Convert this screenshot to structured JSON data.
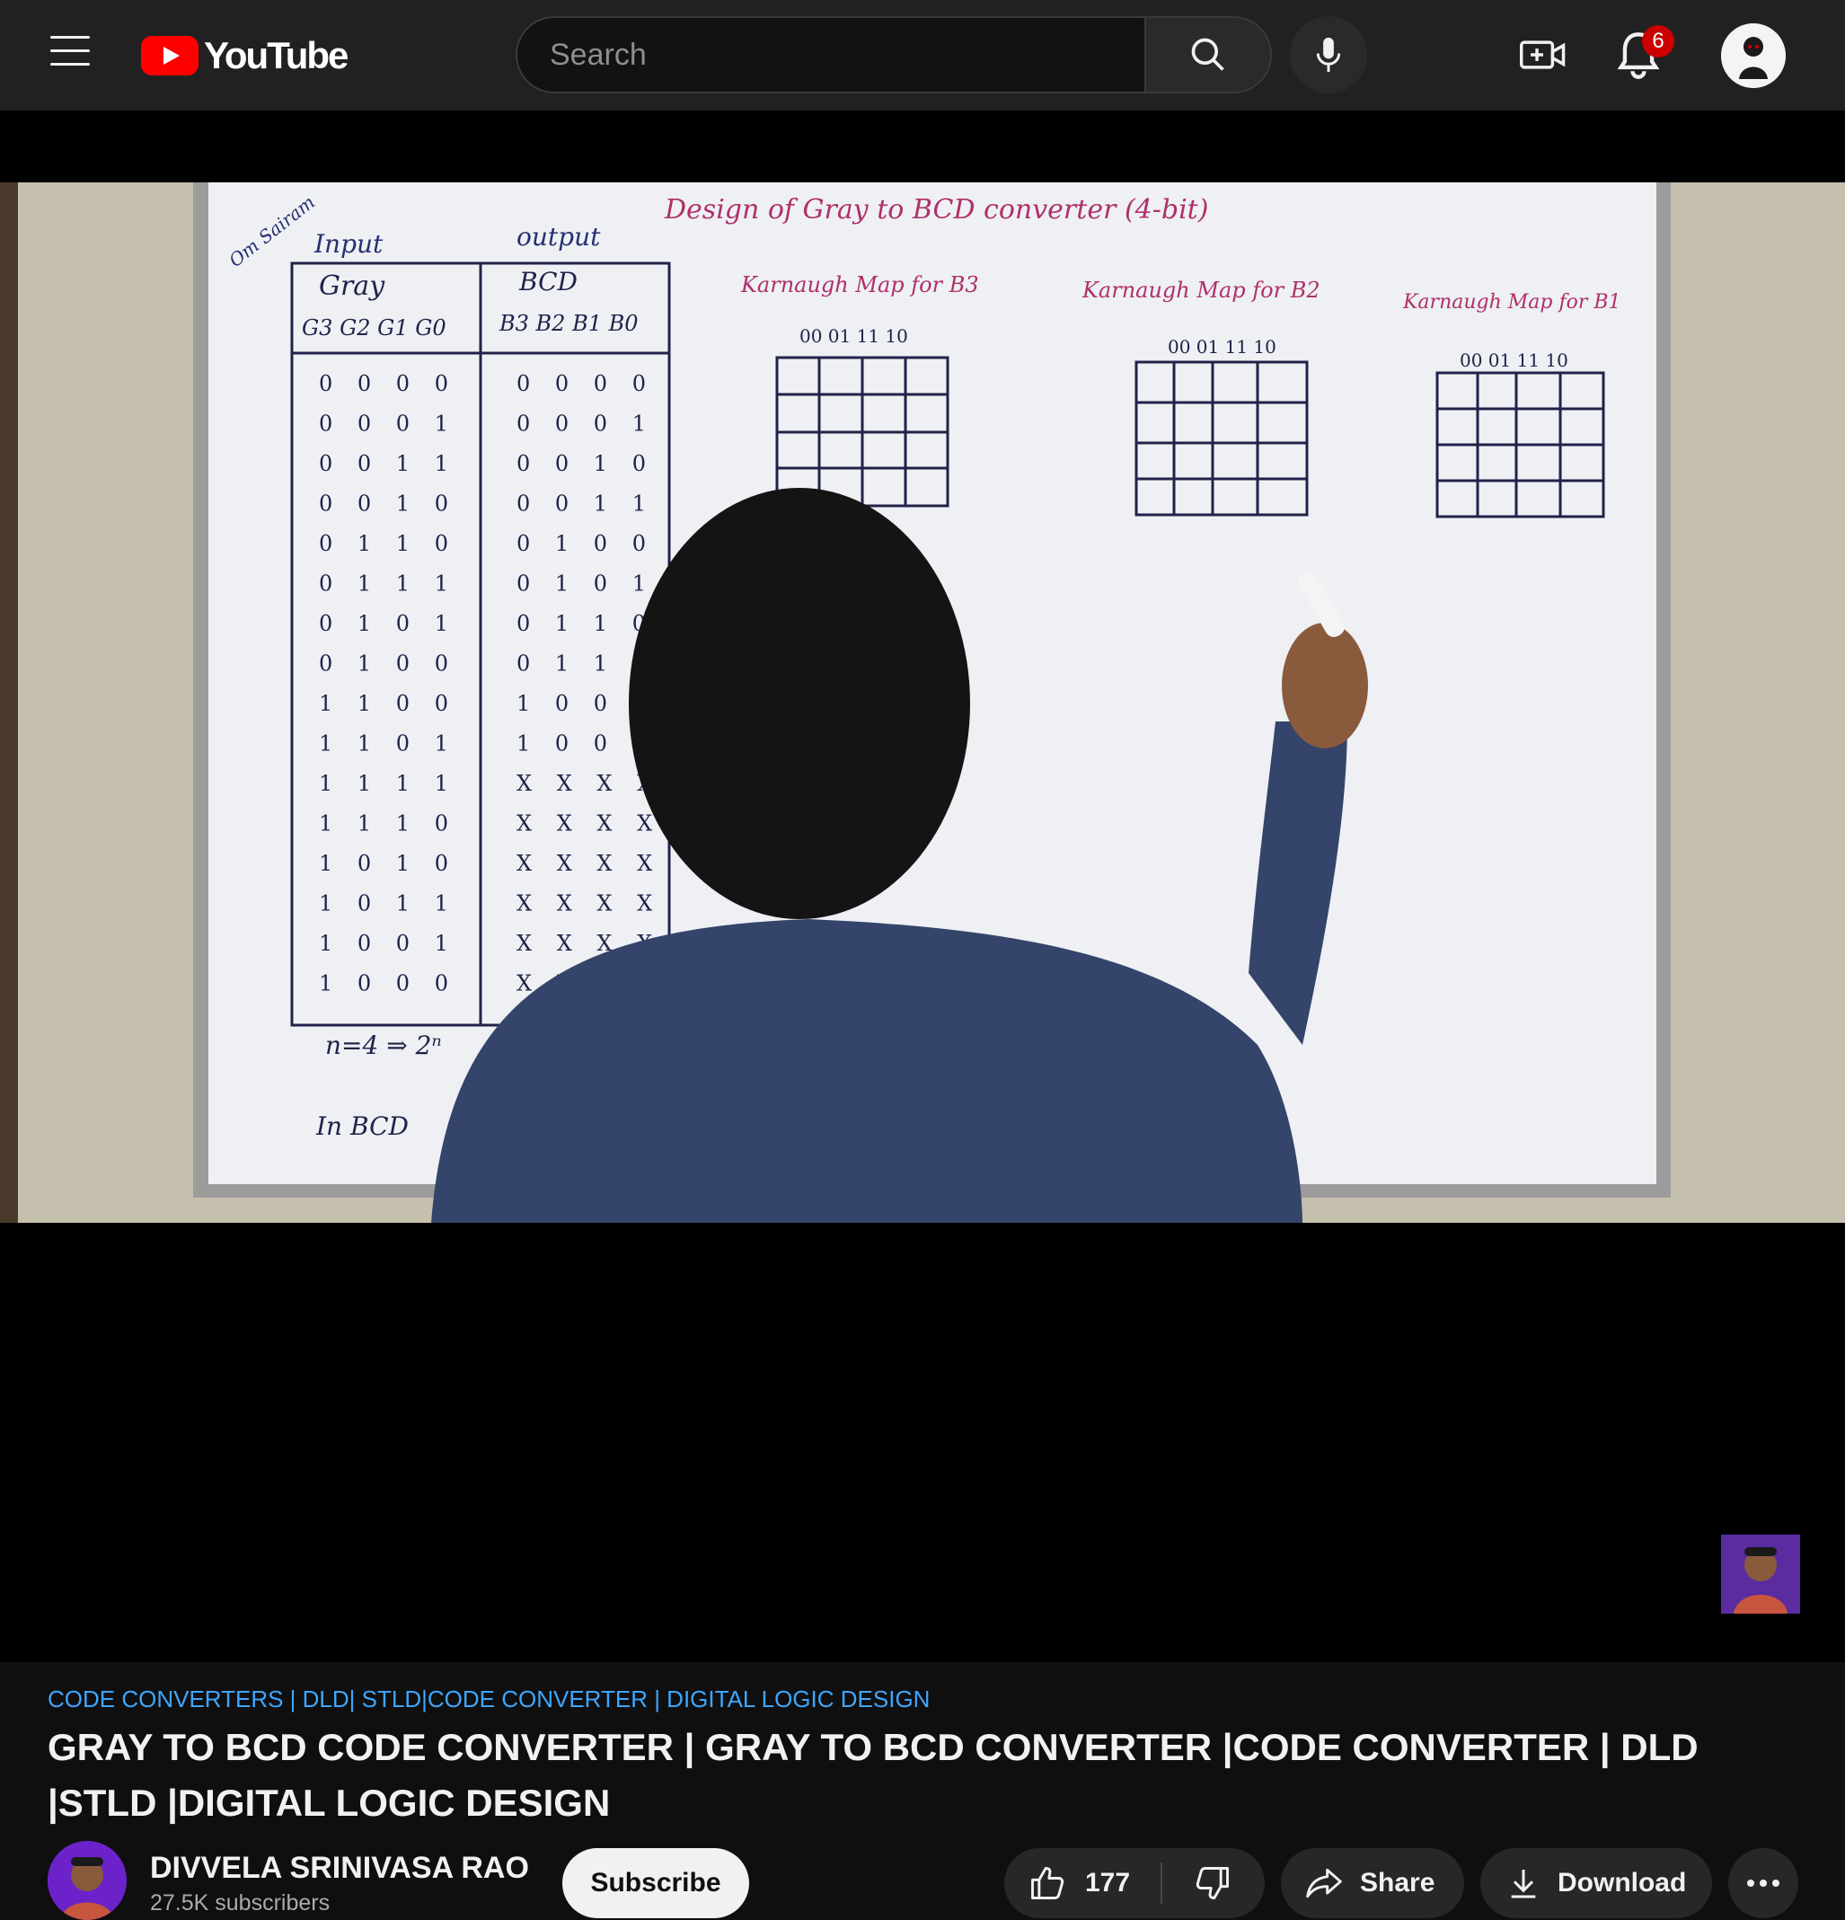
{
  "header": {
    "logo_text": "YouTube",
    "search_placeholder": "Search",
    "notification_count": "6"
  },
  "video": {
    "board": {
      "title": "Design of Gray to BCD converter (4-bit)",
      "corner_note": "Om Sairam",
      "input_label": "Input",
      "output_label": "output",
      "gray_label": "Gray",
      "bcd_label": "BCD",
      "gray_headers": "G3 G2 G1 G0",
      "bcd_headers": "B3 B2 B1 B0",
      "kmap_b3": "Karnaugh Map for B3",
      "kmap_b2": "Karnaugh Map for B2",
      "kmap_b1": "Karnaugh Map for B1",
      "kmap_cols": "00 01 11 10",
      "gray_rows": [
        "0 0 0 0",
        "0 0 0 1",
        "0 0 1 1",
        "0 0 1 0",
        "0 1 1 0",
        "0 1 1 1",
        "0 1 0 1",
        "0 1 0 0",
        "1 1 0 0",
        "1 1 0 1",
        "1 1 1 1",
        "1 1 1 0",
        "1 0 1 0",
        "1 0 1 1",
        "1 0 0 1",
        "1 0 0 0"
      ],
      "bcd_rows": [
        "0 0 0 0",
        "0 0 0 1",
        "0 0 1 0",
        "0 0 1 1",
        "0 1 0 0",
        "0 1 0 1",
        "0 1 1 0",
        "0 1 1 1",
        "1 0 0 0",
        "1 0 0 1",
        "X X X X",
        "X X X X",
        "X X X X",
        "X X X X",
        "X X X X",
        "X X X X"
      ],
      "bottom_note_1": "n=4 ⇒ 2ⁿ",
      "bottom_note_2": "In BCD"
    }
  },
  "meta": {
    "hashtags": "CODE CONVERTERS | DLD| STLD|CODE CONVERTER | DIGITAL LOGIC DESIGN",
    "title": "GRAY TO BCD CODE CONVERTER | GRAY TO BCD CONVERTER |CODE CONVERTER | DLD |STLD |DIGITAL LOGIC DESIGN",
    "channel_name": "DIVVELA SRINIVASA RAO",
    "subscribers": "27.5K subscribers",
    "subscribe_label": "Subscribe",
    "like_count": "177",
    "share_label": "Share",
    "download_label": "Download"
  },
  "colors": {
    "accent_red": "#ff0000",
    "link_blue": "#3ea6ff",
    "badge_red": "#cc0000"
  },
  "icons": [
    "menu-icon",
    "youtube-logo-icon",
    "search-icon",
    "mic-icon",
    "create-icon",
    "bell-icon",
    "like-icon",
    "dislike-icon",
    "share-icon",
    "download-icon",
    "more-icon"
  ]
}
